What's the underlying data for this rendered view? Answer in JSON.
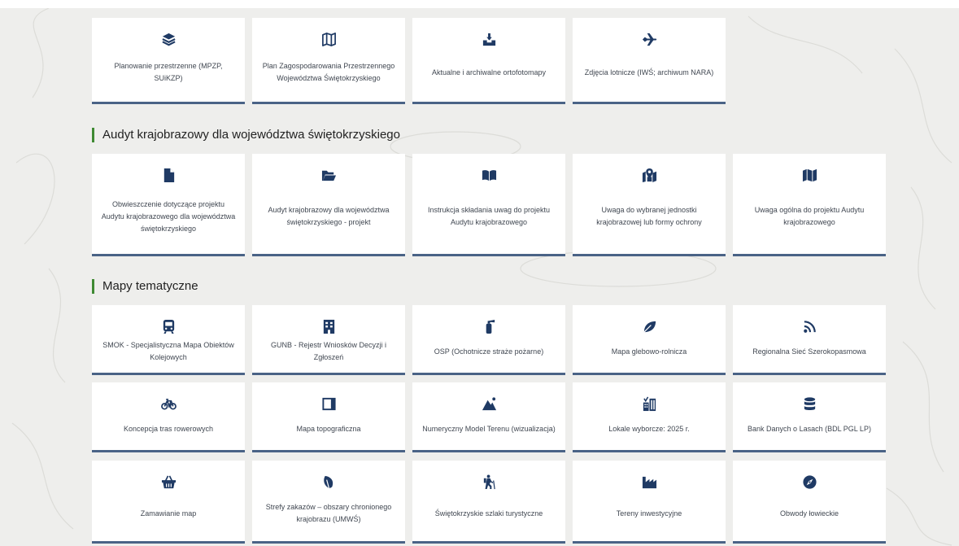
{
  "colors": {
    "icon": "#1f3a64",
    "tile_border": "#4a6386",
    "section_accent": "#3f8a33",
    "background": "#eeeeec"
  },
  "rows": [
    {
      "tiles": [
        {
          "label": "Planowanie przestrzenne (MPZP, SUiKZP)",
          "icon": "layers-icon"
        },
        {
          "label": "Plan Zagospodarowania Przestrzennego Województwa Świętokrzyskiego",
          "icon": "map-outline-icon"
        },
        {
          "label": "Aktualne i archiwalne ortofotomapy",
          "icon": "satellite-download-icon"
        },
        {
          "label": "Zdjęcia lotnicze (IWŚ; archiwum NARA)",
          "icon": "plane-icon"
        }
      ]
    },
    {
      "tiles": [
        {
          "label": "Obwieszczenie dotyczące projektu Audytu krajobrazowego dla województwa świętokrzyskiego",
          "icon": "file-icon"
        },
        {
          "label": "Audyt krajobrazowy dla województwa świętokrzyskiego - projekt",
          "icon": "folder-open-icon"
        },
        {
          "label": "Instrukcja składania uwag do projektu Audytu krajobrazowego",
          "icon": "book-open-icon"
        },
        {
          "label": "Uwaga do wybranej jednostki krajobrazowej lub formy ochrony",
          "icon": "map-marked-icon"
        },
        {
          "label": "Uwaga ogólna do projektu Audytu krajobrazowego",
          "icon": "map-icon"
        }
      ]
    },
    {
      "tiles": [
        {
          "label": "SMOK - Specjalistyczna Mapa Obiektów Kolejowych",
          "icon": "train-icon"
        },
        {
          "label": "GUNB - Rejestr Wniosków Decyzji i Zgłoszeń",
          "icon": "building-icon"
        },
        {
          "label": "OSP (Ochotnicze straże pożarne)",
          "icon": "fire-extinguisher-icon"
        },
        {
          "label": "Mapa glebowo-rolnicza",
          "icon": "leaf-icon"
        },
        {
          "label": "Regionalna Sieć Szerokopasmowa",
          "icon": "rss-icon"
        }
      ]
    },
    {
      "tiles": [
        {
          "label": "Koncepcja tras rowerowych",
          "icon": "bicycle-icon"
        },
        {
          "label": "Mapa topograficzna",
          "icon": "topo-map-icon"
        },
        {
          "label": "Numeryczny Model Terenu (wizualizacja)",
          "icon": "mountain-icon"
        },
        {
          "label": "Lokale wyborcze: 2025 r.",
          "icon": "polling-station-icon"
        },
        {
          "label": "Bank Danych o Lasach (BDL PGL LP)",
          "icon": "database-icon"
        }
      ]
    },
    {
      "tiles": [
        {
          "label": "Zamawianie map",
          "icon": "basket-icon"
        },
        {
          "label": "Strefy zakazów – obszary chronionego krajobrazu (UMWŚ)",
          "icon": "leaf-outline-icon"
        },
        {
          "label": "Świętokrzyskie szlaki turystyczne",
          "icon": "hiking-icon"
        },
        {
          "label": "Tereny inwestycyjne",
          "icon": "industry-icon"
        },
        {
          "label": "Obwody łowieckie",
          "icon": "compass-icon"
        }
      ]
    }
  ],
  "sections": {
    "audit_heading": "Audyt krajobrazowy dla województwa świętokrzyskiego",
    "thematic_heading": "Mapy tematyczne"
  }
}
